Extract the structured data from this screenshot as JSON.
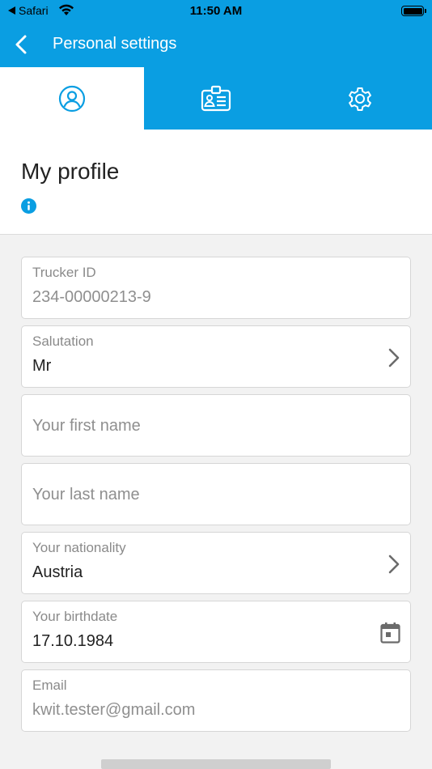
{
  "status_bar": {
    "back_app": "Safari",
    "time": "11:50 AM"
  },
  "nav": {
    "title": "Personal settings",
    "back_icon": "chevron-left-icon"
  },
  "tabs": [
    {
      "icon": "user-circle-icon",
      "active": true
    },
    {
      "icon": "id-card-icon",
      "active": false
    },
    {
      "icon": "gear-icon",
      "active": false
    }
  ],
  "header": {
    "title": "My profile",
    "info_icon": "info-icon"
  },
  "fields": {
    "trucker_id": {
      "label": "Trucker ID",
      "value": "234-00000213-9"
    },
    "salutation": {
      "label": "Salutation",
      "value": "Mr"
    },
    "first_name": {
      "placeholder": "Your first name"
    },
    "last_name": {
      "placeholder": "Your last name"
    },
    "nationality": {
      "label": "Your nationality",
      "value": "Austria"
    },
    "birthdate": {
      "label": "Your birthdate",
      "value": "17.10.1984"
    },
    "email": {
      "label": "Email",
      "value": "kwit.tester@gmail.com"
    }
  },
  "colors": {
    "brand": "#0a9ee2",
    "background": "#f2f2f2"
  }
}
